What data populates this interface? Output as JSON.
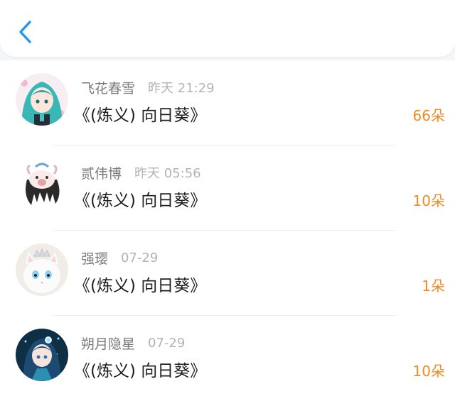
{
  "header": {
    "back_icon": "chevron-left-icon",
    "accent_color": "#2196F3"
  },
  "colors": {
    "count": "#f08a24",
    "name": "#7a7a7a",
    "time": "#b3b3b3"
  },
  "items": [
    {
      "name": "飞花春雪",
      "time": "昨天 21:29",
      "title": "《(炼义) 向日葵》",
      "count": "66朵",
      "avatar": "anime-girl-teal-avatar"
    },
    {
      "name": "贰伟博",
      "time": "昨天 05:56",
      "title": "《(炼义) 向日葵》",
      "count": "10朵",
      "avatar": "cartoon-character-avatar"
    },
    {
      "name": "强璎",
      "time": "07-29",
      "title": "《(炼义) 向日葵》",
      "count": "1朵",
      "avatar": "white-cat-crown-avatar"
    },
    {
      "name": "朔月隐星",
      "time": "07-29",
      "title": "《(炼义) 向日葵》",
      "count": "10朵",
      "avatar": "anime-girl-blue-avatar"
    }
  ]
}
